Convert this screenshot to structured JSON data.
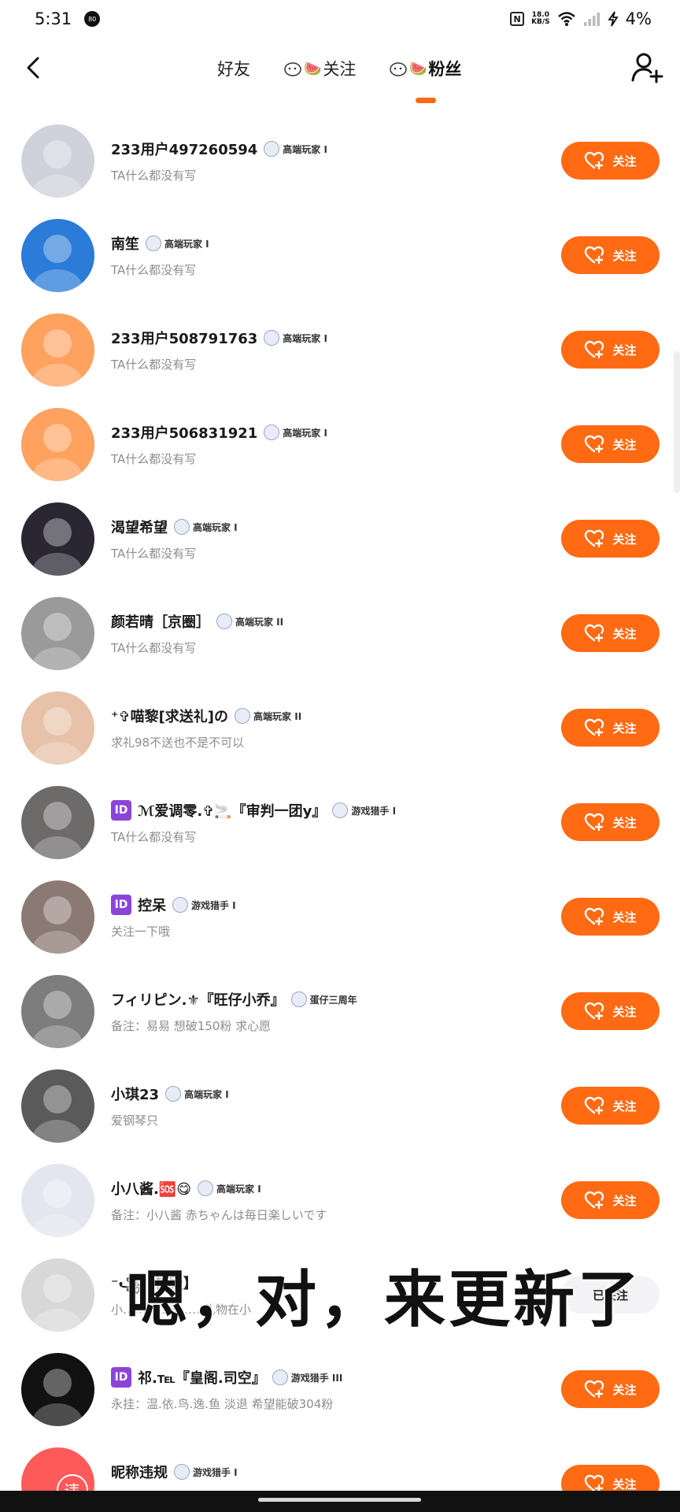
{
  "status_bar": {
    "time": "5:31",
    "notif_badge": "80",
    "nfc": "N",
    "speed": "18.0",
    "speed_unit": "KB/S",
    "battery": "4%"
  },
  "tabs": [
    {
      "label": "好友",
      "emoji": ""
    },
    {
      "label": "关注",
      "emoji": "🍉"
    },
    {
      "label": "粉丝",
      "emoji": "🍉"
    }
  ],
  "active_tab": "粉丝",
  "accent_color": "#ff6a13",
  "follow_label": "关注",
  "followed_label": "已关注",
  "fans": [
    {
      "name": "233用户497260594",
      "level": "高端玩家 I",
      "bio": "TA什么都没有写",
      "followed": false,
      "avatar_color": "#cfd2db",
      "id_badge": false
    },
    {
      "name": "南笙",
      "level": "高端玩家 I",
      "bio": "TA什么都没有写",
      "followed": false,
      "avatar_color": "#2b7bd8",
      "id_badge": false
    },
    {
      "name": "233用户508791763",
      "level": "高端玩家 I",
      "bio": "TA什么都没有写",
      "followed": false,
      "avatar_color": "#ffa25f",
      "id_badge": false
    },
    {
      "name": "233用户506831921",
      "level": "高端玩家 I",
      "bio": "TA什么都没有写",
      "followed": false,
      "avatar_color": "#ffa25f",
      "id_badge": false
    },
    {
      "name": "渴望希望",
      "level": "高端玩家 I",
      "bio": "TA什么都没有写",
      "followed": false,
      "avatar_color": "#2a2733",
      "id_badge": false
    },
    {
      "name": "颜若晴［京圈］",
      "level": "高端玩家 II",
      "bio": "TA什么都没有写",
      "followed": false,
      "avatar_color": "#9a9a9a",
      "id_badge": false
    },
    {
      "name": "⁺✞喵黎[求送礼]の",
      "level": "高端玩家 II",
      "bio": "求礼98不送也不是不可以",
      "followed": false,
      "avatar_color": "#e7c2a8",
      "id_badge": false
    },
    {
      "name": "ℳ爱调零.✞🚬『审判一团y』",
      "level": "游戏猎手 I",
      "bio": "TA什么都没有写",
      "followed": false,
      "avatar_color": "#6d6a6a",
      "id_badge": true,
      "badge_text": "ID"
    },
    {
      "name": "控呆",
      "level": "游戏猎手 I",
      "bio": "关注一下哦",
      "followed": false,
      "avatar_color": "#8b7a73",
      "id_badge": true,
      "badge_text": "ID"
    },
    {
      "name": "フィリピン.⚜『旺仔小乔』",
      "level": "蛋仔三周年",
      "bio": "备注：易易 想破150粉 求心愿",
      "followed": false,
      "avatar_color": "#7d7d7d",
      "id_badge": false
    },
    {
      "name": "小琪23",
      "level": "高端玩家 I",
      "bio": "爱钢琴只",
      "followed": false,
      "avatar_color": "#5a5a5a",
      "id_badge": false
    },
    {
      "name": "小八酱.🆘😋",
      "level": "高端玩家 I",
      "bio": "备注：小八酱 赤ちゃんは毎日楽しいです",
      "followed": false,
      "avatar_color": "#e3e6ee",
      "id_badge": false
    },
    {
      "name": "⁻꧁【神殿】",
      "level": "",
      "bio": "小……6358 ……礼物在小",
      "followed": true,
      "avatar_color": "#d8d8d8",
      "id_badge": false
    },
    {
      "name": "祁.℡『皇阁.司空』",
      "level": "游戏猎手 III",
      "bio": "永挂：温.依.鸟.逸.鱼 淡退 希望能破304粉",
      "followed": false,
      "avatar_color": "#111111",
      "id_badge": true,
      "badge_text": "ID"
    },
    {
      "name": "昵称违规",
      "level": "游戏猎手 I",
      "bio": "",
      "followed": false,
      "avatar_color": "#ff5a5a",
      "id_badge": false,
      "avatar_text": "违"
    }
  ],
  "subtitle_overlay": "嗯，对，来更新了"
}
